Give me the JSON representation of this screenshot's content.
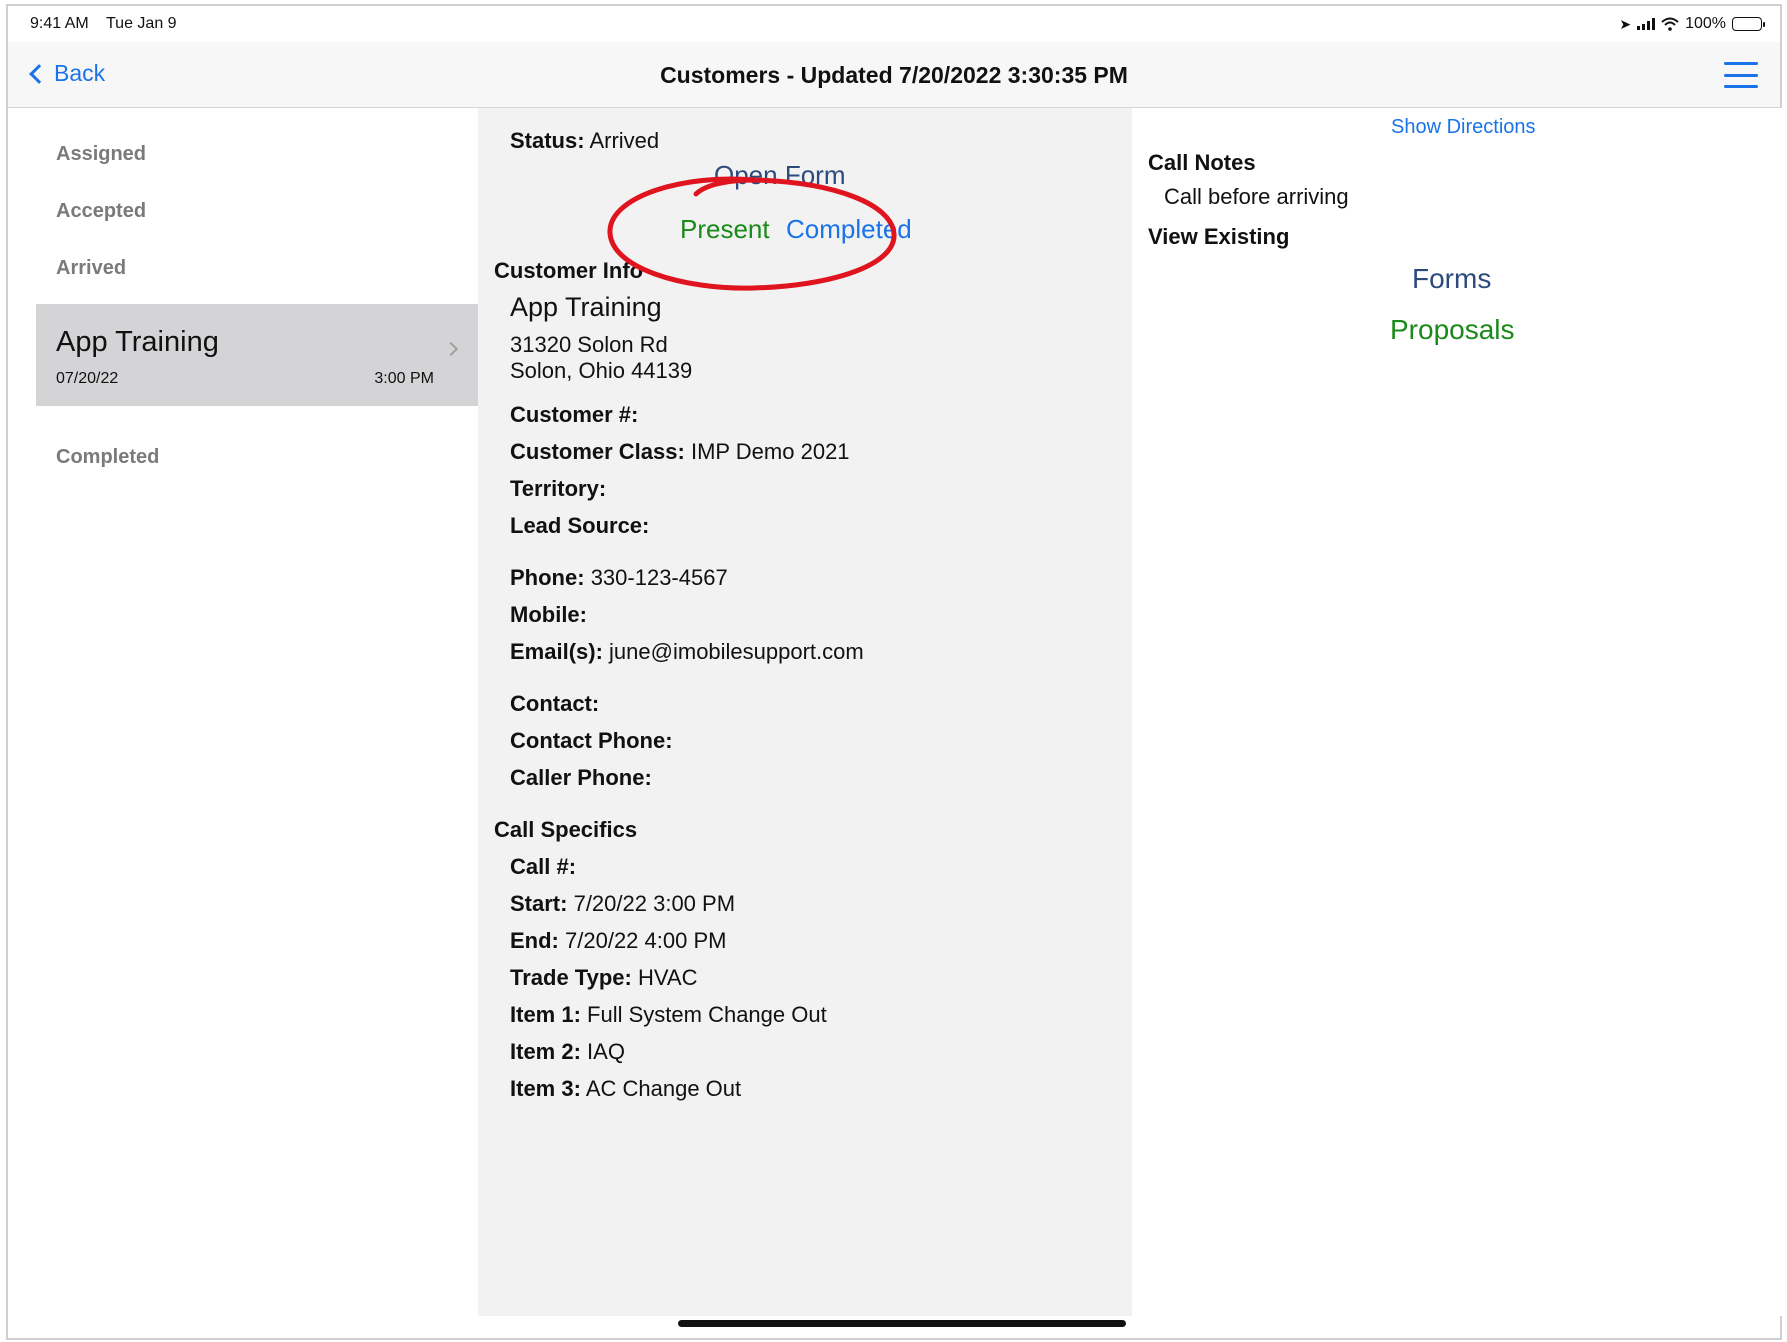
{
  "status_bar": {
    "time": "9:41 AM",
    "date": "Tue Jan 9",
    "battery": "100%"
  },
  "nav": {
    "back_label": "Back",
    "title": "Customers - Updated 7/20/2022 3:30:35 PM"
  },
  "sidebar": {
    "sections": [
      "Assigned",
      "Accepted",
      "Arrived",
      "Completed"
    ],
    "selected_item": {
      "title": "App Training",
      "date": "07/20/22",
      "time": "3:00 PM"
    }
  },
  "detail": {
    "status_label": "Status:",
    "status_value": "Arrived",
    "open_form": "Open Form",
    "present": "Present",
    "completed": "Completed",
    "customer_info_header": "Customer Info",
    "customer_name": "App Training",
    "address_line1": "31320 Solon Rd",
    "address_line2": "Solon, Ohio 44139",
    "customer_num_label": "Customer #:",
    "customer_class_label": "Customer Class:",
    "customer_class_value": "IMP Demo 2021",
    "territory_label": "Territory:",
    "lead_source_label": "Lead Source:",
    "phone_label": "Phone:",
    "phone_value": "330-123-4567",
    "mobile_label": "Mobile:",
    "email_label": "Email(s):",
    "email_value": "june@imobilesupport.com",
    "contact_label": "Contact:",
    "contact_phone_label": "Contact Phone:",
    "caller_phone_label": "Caller Phone:",
    "call_specifics_header": "Call Specifics",
    "call_num_label": "Call #:",
    "start_label": "Start:",
    "start_value": "7/20/22 3:00 PM",
    "end_label": "End:",
    "end_value": "7/20/22 4:00 PM",
    "trade_type_label": "Trade Type:",
    "trade_type_value": "HVAC",
    "item1_label": "Item 1:",
    "item1_value": "Full System Change Out",
    "item2_label": "Item 2:",
    "item2_value": "IAQ",
    "item3_label": "Item 3:",
    "item3_value": "AC Change Out"
  },
  "right_panel": {
    "show_directions": "Show Directions",
    "call_notes_header": "Call Notes",
    "call_notes_text": "Call before arriving",
    "view_existing_header": "View Existing",
    "forms_link": "Forms",
    "proposals_link": "Proposals"
  },
  "colors": {
    "accent_blue": "#1a73e8",
    "link_green": "#1a8a1a",
    "link_dark": "#2c4a7c",
    "annotation_red": "#e0141e"
  }
}
